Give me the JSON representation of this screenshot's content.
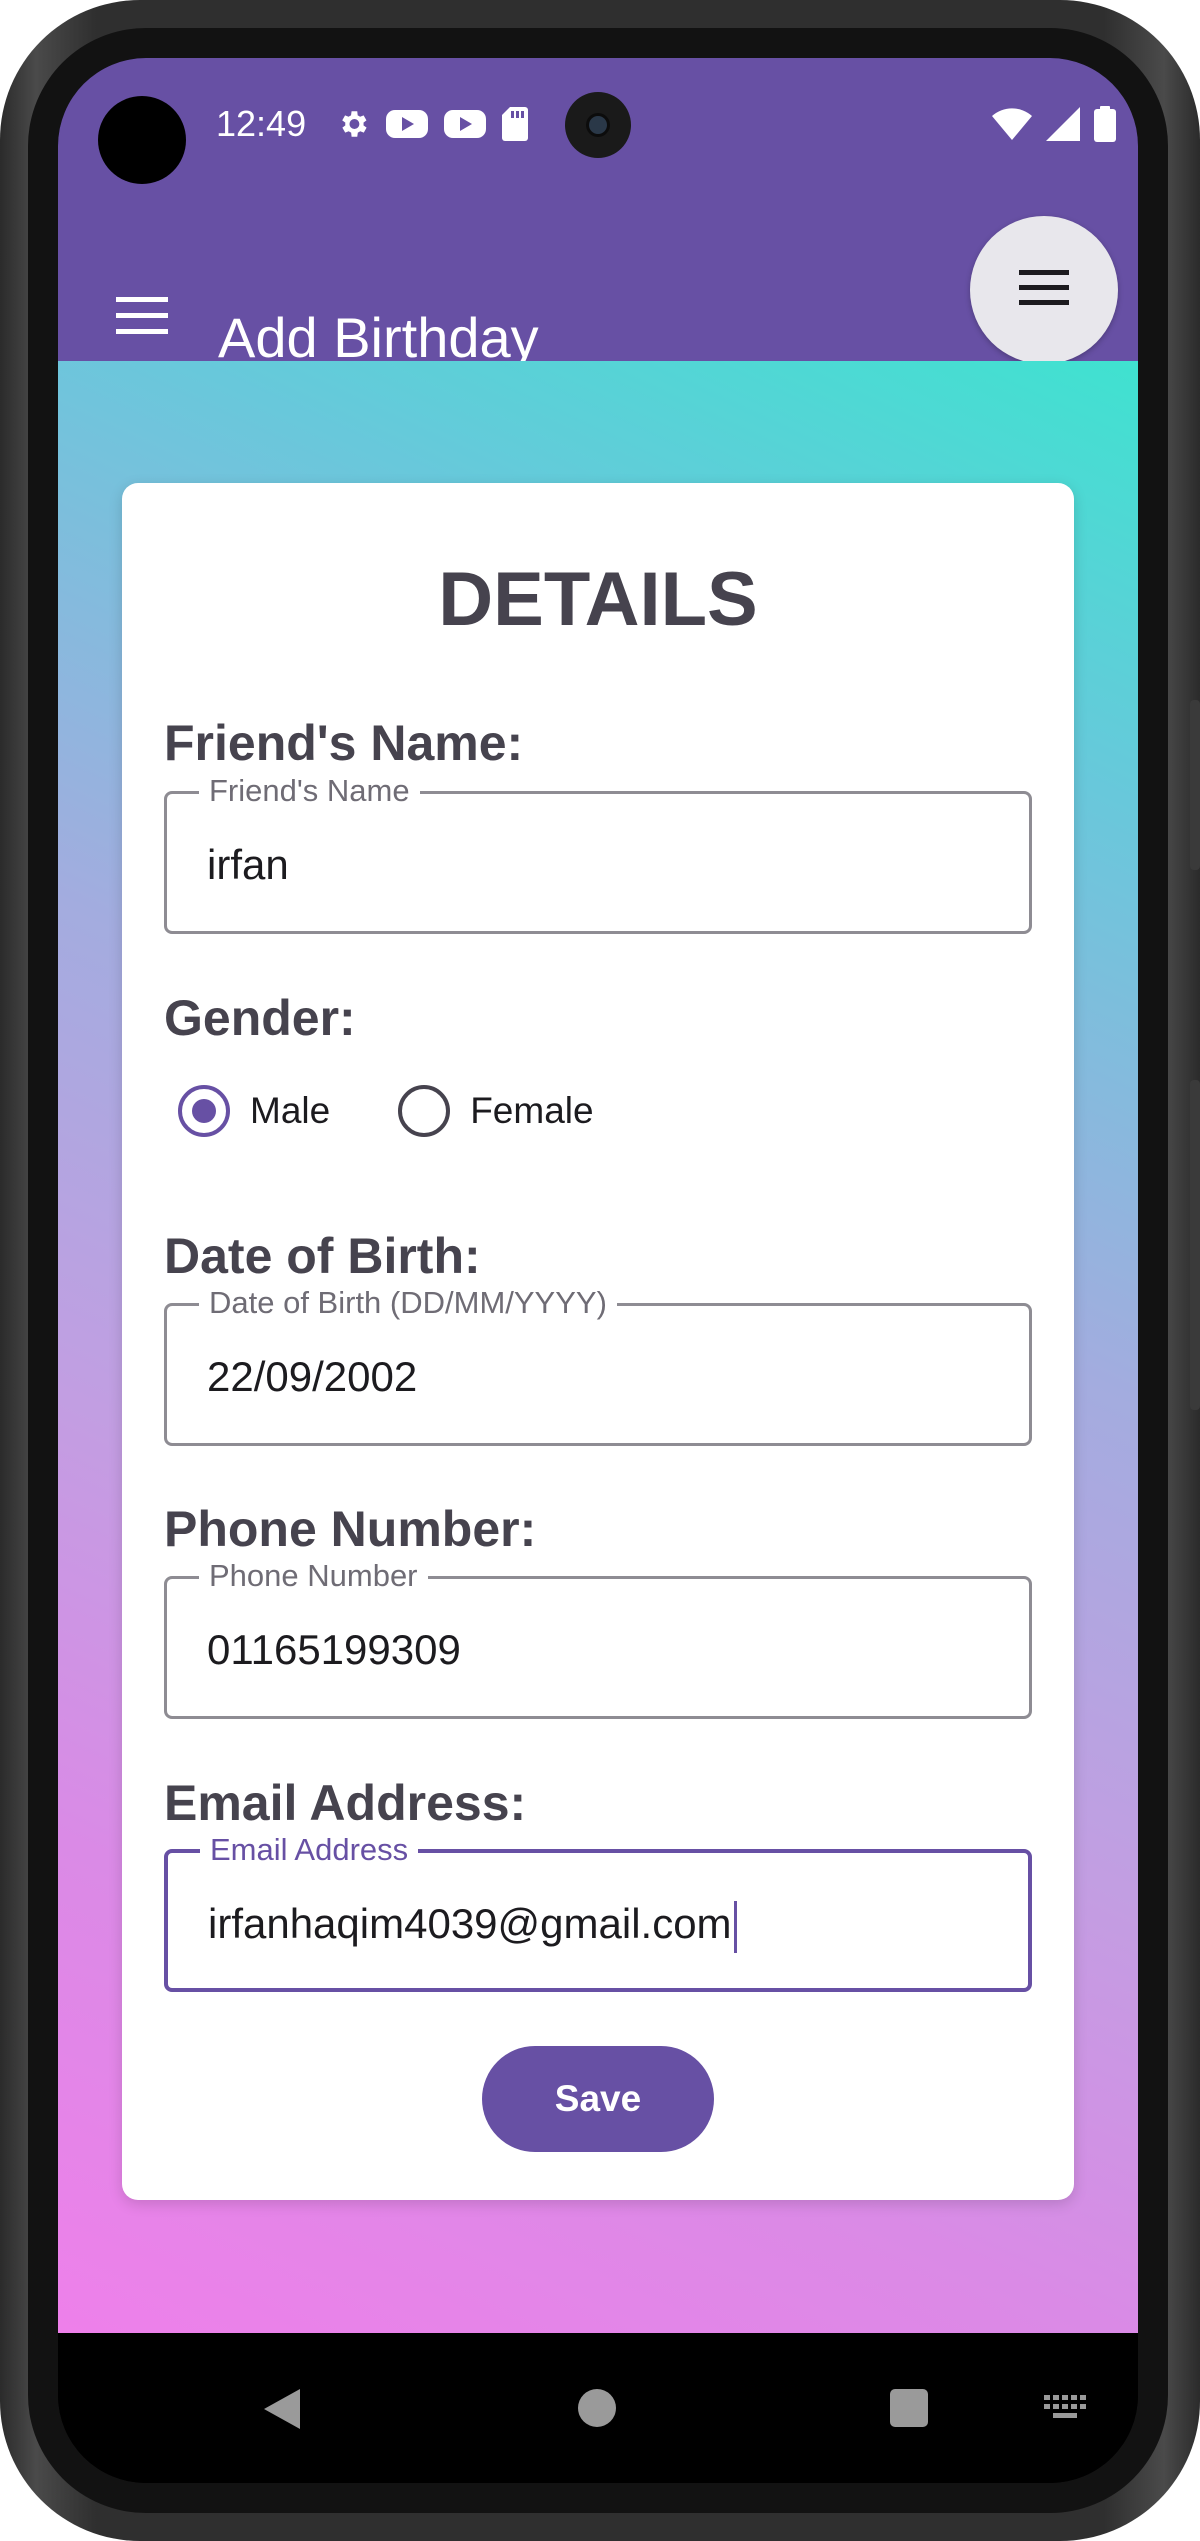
{
  "status_bar": {
    "time": "12:49",
    "left_icons": [
      "settings-icon",
      "youtube-icon",
      "youtube-icon",
      "sd-card-icon"
    ],
    "right_icons": [
      "wifi-icon",
      "signal-icon",
      "battery-icon"
    ]
  },
  "app_bar": {
    "title": "Add Birthday",
    "nav_icon": "menu-icon",
    "action_icon": "menu-icon"
  },
  "form": {
    "title": "DETAILS",
    "friend_name": {
      "heading": "Friend's Name:",
      "label": "Friend's Name",
      "value": "irfan"
    },
    "gender": {
      "heading": "Gender:",
      "options": [
        {
          "label": "Male",
          "checked": true
        },
        {
          "label": "Female",
          "checked": false
        }
      ]
    },
    "dob": {
      "heading": "Date of Birth:",
      "label": "Date of Birth (DD/MM/YYYY)",
      "value": "22/09/2002"
    },
    "phone": {
      "heading": "Phone Number:",
      "label": "Phone Number",
      "value": "01165199309"
    },
    "email": {
      "heading": "Email Address:",
      "label": "Email Address",
      "value": "irfanhaqim4039@gmail.com",
      "focused": true
    },
    "save_label": "Save"
  },
  "colors": {
    "primary": "#6750a4",
    "gradient_top": "#3fe2d0",
    "gradient_bottom": "#ee80ea",
    "heading_text": "#46434e"
  },
  "nav_bar": {
    "icons": [
      "back-icon",
      "home-icon",
      "recents-icon",
      "keyboard-icon"
    ]
  }
}
